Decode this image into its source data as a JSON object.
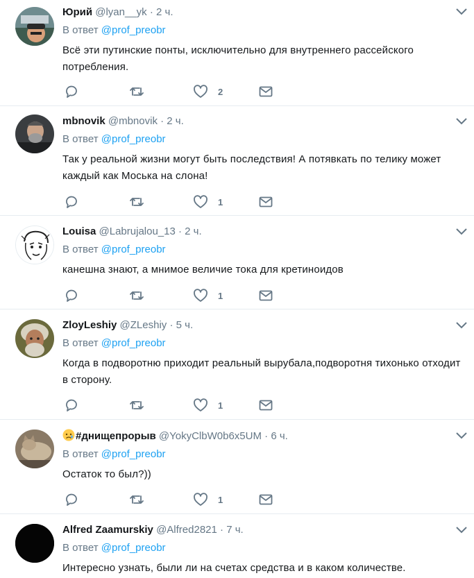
{
  "tweets": [
    {
      "name": "Юрий",
      "handle": "@lyan__yk",
      "dot": "·",
      "time": "2 ч.",
      "reply_prefix": "В ответ",
      "reply_mention": "@prof_preobr",
      "text": "Всё эти путинские понты, исключительно для внутреннего рассейского потребления.",
      "likes": "2",
      "avatar": "person-with-cap-avatar"
    },
    {
      "name": "mbnovik",
      "handle": "@mbnovik",
      "dot": "·",
      "time": "2 ч.",
      "reply_prefix": "В ответ",
      "reply_mention": "@prof_preobr",
      "text": "Так у реальной жизни могут быть последствия!  А потявкать по телику может каждый как Моська на слона!",
      "likes": "1",
      "avatar": "bearded-man-avatar"
    },
    {
      "name": "Louisa",
      "handle": "@Labrujalou_13",
      "dot": "·",
      "time": "2 ч.",
      "reply_prefix": "В ответ",
      "reply_mention": "@prof_preobr",
      "text": "канешна знают, а мнимое величие тока для кретиноидов",
      "likes": "1",
      "avatar": "sketch-face-avatar"
    },
    {
      "name": "ZloyLeshiy",
      "handle": "@ZLeshiy",
      "dot": "·",
      "time": "5 ч.",
      "reply_prefix": "В ответ",
      "reply_mention": "@prof_preobr",
      "text": "Когда в подворотню приходит реальный вырубала,подворотня тихонько отходит в сторону.",
      "likes": "1",
      "avatar": "old-man-avatar"
    },
    {
      "name": "#днищепрорыв",
      "handle": "@YokyClbW0b6x5UM",
      "dot": "·",
      "time": "6 ч.",
      "reply_prefix": "В ответ",
      "reply_mention": "@prof_preobr",
      "text": "Остаток то был?))",
      "likes": "1",
      "avatar": "cat-photo-avatar",
      "name_emoji": "sad-face-emoji"
    },
    {
      "name": "Alfred Zaamurskiy",
      "handle": "@Alfred2821",
      "dot": "·",
      "time": "7 ч.",
      "reply_prefix": "В ответ",
      "reply_mention": "@prof_preobr",
      "text": "Интересно узнать, были ли на счетах средства и в каком количестве.",
      "likes": "",
      "avatar": "black-circle-avatar"
    }
  ],
  "colors": {
    "accent": "#1da1f2",
    "secondary_text": "#657786",
    "divider": "#e6ecf0",
    "primary_text": "#14171a"
  }
}
